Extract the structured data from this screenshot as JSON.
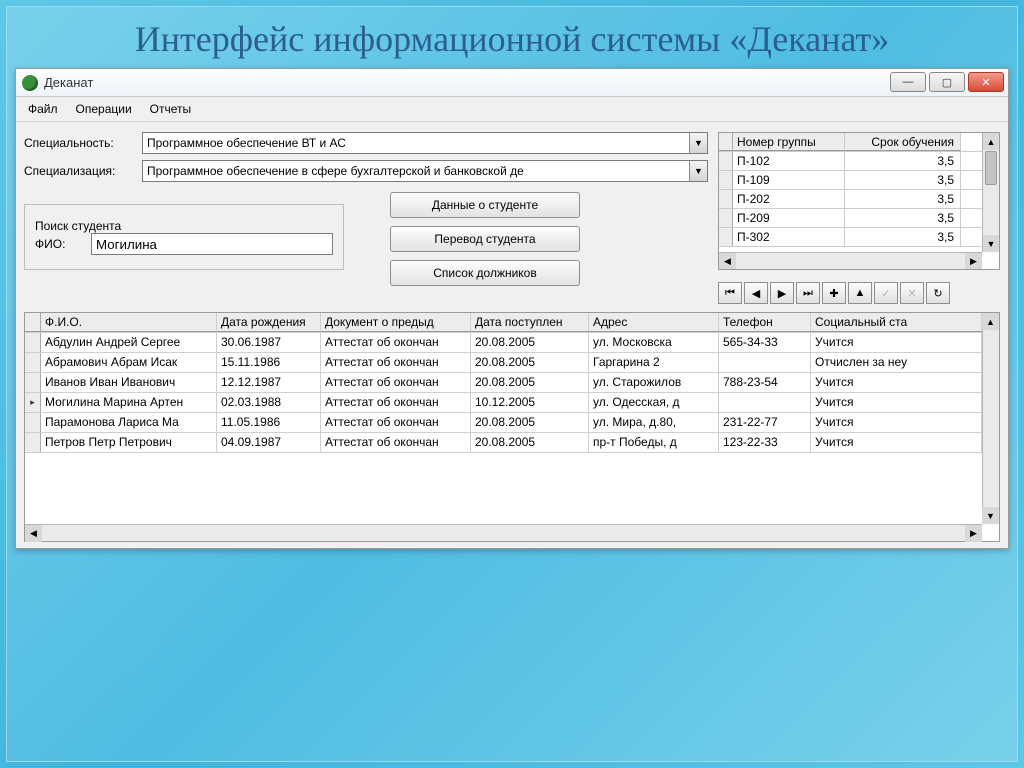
{
  "slide_title": "Интерфейс информационной системы «Деканат»",
  "window": {
    "title": "Деканат"
  },
  "menu": {
    "file": "Файл",
    "operations": "Операции",
    "reports": "Отчеты"
  },
  "form": {
    "specialty_label": "Специальность:",
    "specialty_value": "Программное обеспечение ВТ и АС",
    "specialization_label": "Специализация:",
    "specialization_value": "Программное обеспечение в сфере бухгалтерской и банковской де"
  },
  "groups": {
    "col_group": "Номер группы",
    "col_term": "Срок обучения",
    "rows": [
      {
        "group": "П-102",
        "term": "3,5"
      },
      {
        "group": "П-109",
        "term": "3,5"
      },
      {
        "group": "П-202",
        "term": "3,5"
      },
      {
        "group": "П-209",
        "term": "3,5"
      },
      {
        "group": "П-302",
        "term": "3,5"
      }
    ]
  },
  "search": {
    "legend": "Поиск студента",
    "fio_label": "ФИО:",
    "fio_value": "Могилина"
  },
  "actions": {
    "details": "Данные о студенте",
    "transfer": "Перевод студента",
    "debtors": "Список должников"
  },
  "grid": {
    "cols": {
      "fio": "Ф.И.О.",
      "dob": "Дата рождения",
      "doc": "Документ о предыд",
      "adm": "Дата поступлен",
      "addr": "Адрес",
      "phone": "Телефон",
      "soc": "Социальный ста"
    },
    "rows": [
      {
        "ptr": "",
        "fio": "Абдулин Андрей Сергее",
        "dob": "30.06.1987",
        "doc": "Аттестат об окончан",
        "adm": "20.08.2005",
        "addr": "ул. Московска",
        "phone": "565-34-33",
        "soc": "Учится"
      },
      {
        "ptr": "",
        "fio": "Абрамович Абрам Исак",
        "dob": "15.11.1986",
        "doc": "Аттестат об окончан",
        "adm": "20.08.2005",
        "addr": "Гаргарина 2",
        "phone": "",
        "soc": "Отчислен за неу"
      },
      {
        "ptr": "",
        "fio": "Иванов Иван Иванович",
        "dob": "12.12.1987",
        "doc": "Аттестат об окончан",
        "adm": "20.08.2005",
        "addr": "ул. Старожилов",
        "phone": "788-23-54",
        "soc": "Учится"
      },
      {
        "ptr": "▸",
        "fio": "Могилина Марина Артен",
        "dob": "02.03.1988",
        "doc": "Аттестат об окончан",
        "adm": "10.12.2005",
        "addr": "ул. Одесская, д",
        "phone": "",
        "soc": "Учится"
      },
      {
        "ptr": "",
        "fio": "Парамонова Лариса Ма",
        "dob": "11.05.1986",
        "doc": "Аттестат об окончан",
        "adm": "20.08.2005",
        "addr": "ул. Мира, д.80,",
        "phone": "231-22-77",
        "soc": "Учится"
      },
      {
        "ptr": "",
        "fio": "Петров Петр Петрович",
        "dob": "04.09.1987",
        "doc": "Аттестат об окончан",
        "adm": "20.08.2005",
        "addr": "пр-т Победы, д",
        "phone": "123-22-33",
        "soc": "Учится"
      }
    ]
  },
  "nav_glyphs": {
    "first": "⏮",
    "prev": "◀",
    "next": "▶",
    "last": "⏭",
    "add": "✚",
    "del": "▲",
    "post": "✓",
    "cancel": "✕",
    "refresh": "↻"
  }
}
